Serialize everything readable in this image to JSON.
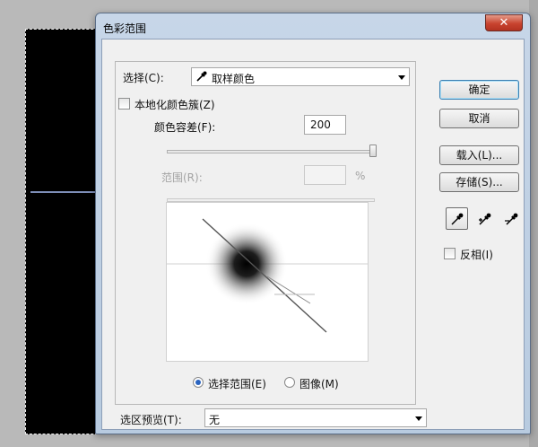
{
  "dialog": {
    "title": "色彩范围",
    "close_label": "✕",
    "select": {
      "label": "选择(C):",
      "value": "取样颜色"
    },
    "localized_clusters": {
      "label": "本地化颜色簇(Z)",
      "checked": false
    },
    "fuzziness": {
      "label": "颜色容差(F):",
      "value": "200",
      "slider_fraction": 1.0
    },
    "range": {
      "label": "范围(R):",
      "value": "",
      "unit": "%",
      "enabled": false
    },
    "view": {
      "options": [
        {
          "label": "选择范围(E)",
          "selected": true
        },
        {
          "label": "图像(M)",
          "selected": false
        }
      ]
    },
    "selection_preview": {
      "label": "选区预览(T):",
      "value": "无"
    },
    "buttons": {
      "ok": "确定",
      "cancel": "取消",
      "load": "载入(L)...",
      "save": "存储(S)..."
    },
    "tools": [
      "eyedropper-icon",
      "eyedropper-plus-icon",
      "eyedropper-minus-icon"
    ],
    "invert": {
      "label": "反相(I)",
      "checked": false
    }
  },
  "colors": {
    "dialog_frame": "#bfd0e4",
    "close_button": "#c8432f",
    "client_bg": "#f0f0f0",
    "canvas": "#000000"
  }
}
